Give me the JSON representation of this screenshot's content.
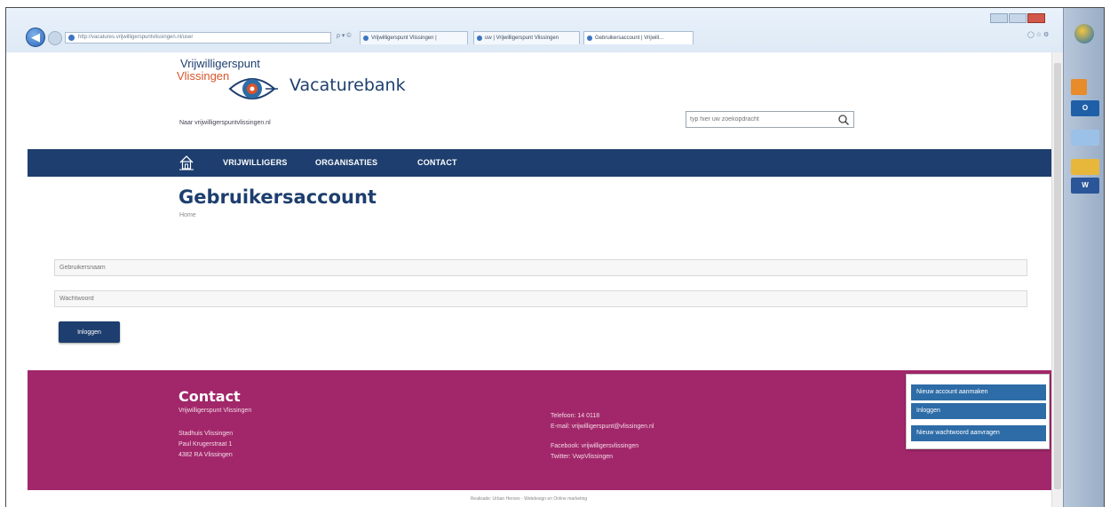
{
  "browser": {
    "address": "http://vacatures.vrijwilligerspuntvlissingen.nl/user",
    "address_tools": "ρ ▾ ©",
    "tabs": [
      "Vrijwilligerspunt Vlissingen |",
      "uw | Vrijwilligerspunt Vlissingen",
      "Gebruikersaccount | Vrijwill..."
    ]
  },
  "header": {
    "logo_line1": "Vrijwilligerspunt",
    "logo_line2": "Vlissingen",
    "site_title": "Vacaturebank",
    "back_link": "Naar vrijwilligerspuntvlissingen.nl",
    "search_placeholder": "typ hier uw zoekopdracht"
  },
  "nav": {
    "items": [
      "VRIJWILLIGERS",
      "ORGANISATIES",
      "CONTACT"
    ]
  },
  "content": {
    "title": "Gebruikersaccount",
    "breadcrumb": "Home",
    "username_placeholder": "Gebruikersnaam",
    "password_placeholder": "Wachtwoord",
    "login_label": "Inloggen"
  },
  "footer": {
    "title": "Contact",
    "org": "Vrijwilligerspunt Vlissingen",
    "address": [
      "Stadhuis Vlissingen",
      "Paul Krugerstraat 1",
      "4382 RA Vlissingen"
    ],
    "phone": "Telefoon: 14 0118",
    "email": "E-mail: vrijwilligerspunt@vlissingen.nl",
    "facebook": "Facebook: vrijwilligersvlissingen",
    "twitter": "Twitter: VwpVlissingen",
    "credits": "Realisatie: Urban Heroes - Webdesign en Online marketing"
  },
  "popup": {
    "items": [
      "Nieuw account aanmaken",
      "Inloggen",
      "Nieuw wachtwoord aanvragen"
    ]
  },
  "colors": {
    "navy": "#1d3e6e",
    "magenta": "#a2276a",
    "popup_blue": "#2d6ca7",
    "logo_orange": "#d9552a"
  }
}
